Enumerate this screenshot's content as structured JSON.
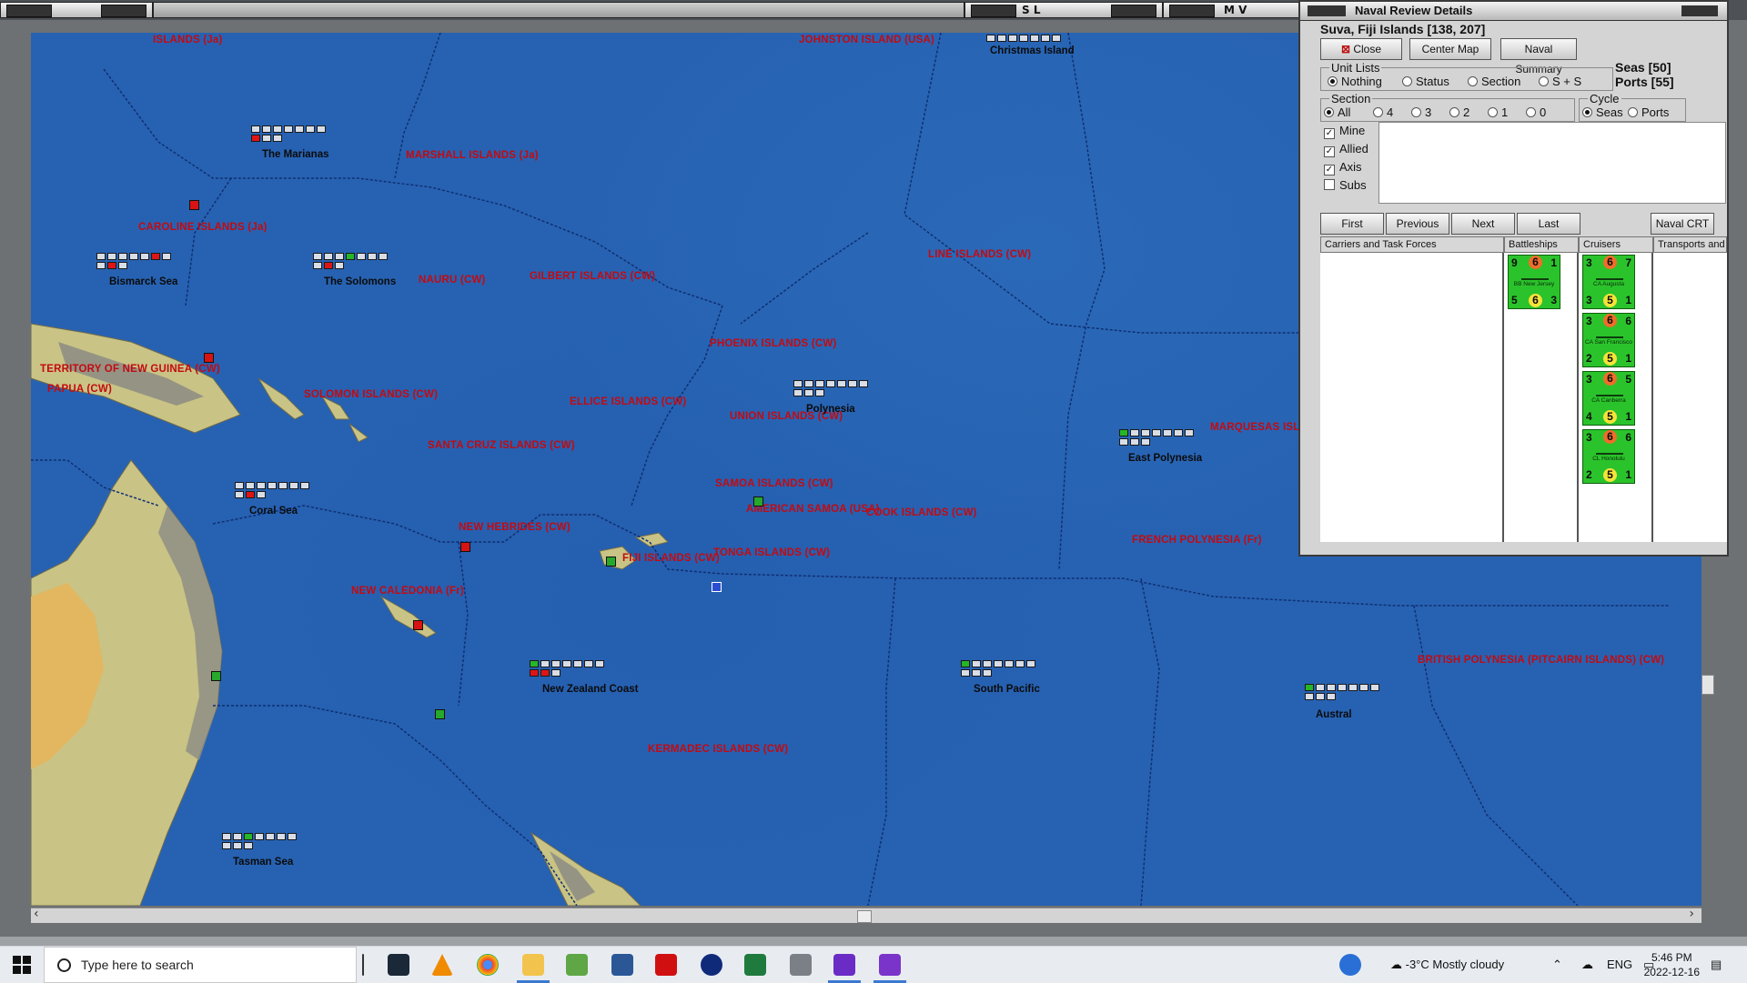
{
  "windows": {
    "map_title": "",
    "sl_title": "S L",
    "mv_title": "M V"
  },
  "map": {
    "sea_labels": [
      {
        "text": "ISLANDS (Ja)"
      },
      {
        "text": "JOHNSTON ISLAND (USA)"
      },
      {
        "text": "MARSHALL ISLANDS (Ja)"
      },
      {
        "text": "CAROLINE ISLANDS (Ja)"
      },
      {
        "text": "GILBERT ISLANDS (CW)"
      },
      {
        "text": "NAURU (CW)"
      },
      {
        "text": "LINE ISLANDS (CW)"
      },
      {
        "text": "PHOENIX ISLANDS (CW)"
      },
      {
        "text": "TERRITORY OF NEW GUINEA (CW)"
      },
      {
        "text": "PAPUA (CW)"
      },
      {
        "text": "SOLOMON ISLANDS (CW)"
      },
      {
        "text": "ELLICE ISLANDS (CW)"
      },
      {
        "text": "UNION ISLANDS (CW)"
      },
      {
        "text": "SANTA CRUZ ISLANDS (CW)"
      },
      {
        "text": "MARQUESAS ISL"
      },
      {
        "text": "SAMOA ISLANDS (CW)"
      },
      {
        "text": "AMERICAN SAMOA (USA)"
      },
      {
        "text": "COOK ISLANDS (CW)"
      },
      {
        "text": "NEW HEBRIDES (CW)"
      },
      {
        "text": "FRENCH POLYNESIA (Fr)"
      },
      {
        "text": "FIJI ISLANDS (CW)"
      },
      {
        "text": "TONGA ISLANDS (CW)"
      },
      {
        "text": "NEW CALEDONIA (Fr)"
      },
      {
        "text": "BRITISH POLYNESIA (PITCAIRN ISLANDS) (CW)"
      },
      {
        "text": "KERMADEC ISLANDS (CW)"
      }
    ],
    "zones": [
      {
        "name": "Christmas Island"
      },
      {
        "name": "The Marianas"
      },
      {
        "name": "Bismarck Sea"
      },
      {
        "name": "The Solomons"
      },
      {
        "name": "Polynesia"
      },
      {
        "name": "East Polynesia"
      },
      {
        "name": "Coral Sea"
      },
      {
        "name": "New Zealand Coast"
      },
      {
        "name": "South Pacific"
      },
      {
        "name": "Austral"
      },
      {
        "name": "Tasman Sea"
      }
    ]
  },
  "naval": {
    "title": "Naval Review Details",
    "location": "Suva, Fiji Islands [138, 207]",
    "buttons": {
      "close": "Close",
      "center": "Center Map",
      "summary": "Naval Summary"
    },
    "unit_lists": {
      "label": "Unit Lists",
      "options": [
        "Nothing",
        "Status",
        "Section",
        "S + S"
      ],
      "selected": "Nothing"
    },
    "seas": "Seas [50]",
    "ports": "Ports [55]",
    "section": {
      "label": "Section",
      "options": [
        "All",
        "4",
        "3",
        "2",
        "1",
        "0"
      ],
      "selected": "All"
    },
    "cycle": {
      "label": "Cycle",
      "options": [
        "Seas",
        "Ports"
      ],
      "selected": "Seas"
    },
    "filters": [
      {
        "label": "Mine",
        "checked": true
      },
      {
        "label": "Allied",
        "checked": true
      },
      {
        "label": "Axis",
        "checked": true
      },
      {
        "label": "Subs",
        "checked": false
      }
    ],
    "nav": {
      "first": "First",
      "previous": "Previous",
      "next": "Next",
      "last": "Last",
      "crt": "Naval CRT"
    },
    "columns": [
      "Carriers and Task Forces",
      "Battleships",
      "Cruisers",
      "Transports and"
    ],
    "battleships": [
      {
        "name": "BB New Jersey",
        "tl": "9",
        "tm": "6",
        "tr": "1",
        "bl": "5",
        "bm": "6",
        "br": "3"
      }
    ],
    "cruisers": [
      {
        "name": "CA Augusta",
        "tl": "3",
        "tm": "6",
        "tr": "7",
        "bl": "3",
        "bm": "5",
        "br": "1"
      },
      {
        "name": "CA San Francisco",
        "tl": "3",
        "tm": "6",
        "tr": "6",
        "bl": "2",
        "bm": "5",
        "br": "1"
      },
      {
        "name": "CA Canberra",
        "tl": "3",
        "tm": "6",
        "tr": "5",
        "bl": "4",
        "bm": "5",
        "br": "1"
      },
      {
        "name": "CL Honolulu",
        "tl": "3",
        "tm": "6",
        "tr": "6",
        "bl": "2",
        "bm": "5",
        "br": "1"
      }
    ]
  },
  "taskbar": {
    "search_placeholder": "Type here to search",
    "weather": "-3°C  Mostly cloudy",
    "lang": "ENG",
    "time": "5:46 PM",
    "date": "2022-12-16"
  },
  "colors": {
    "sea": "#2762b2",
    "land": "#d6c987",
    "label_red": "#c40a10",
    "unit_green": "#2bc32b"
  }
}
